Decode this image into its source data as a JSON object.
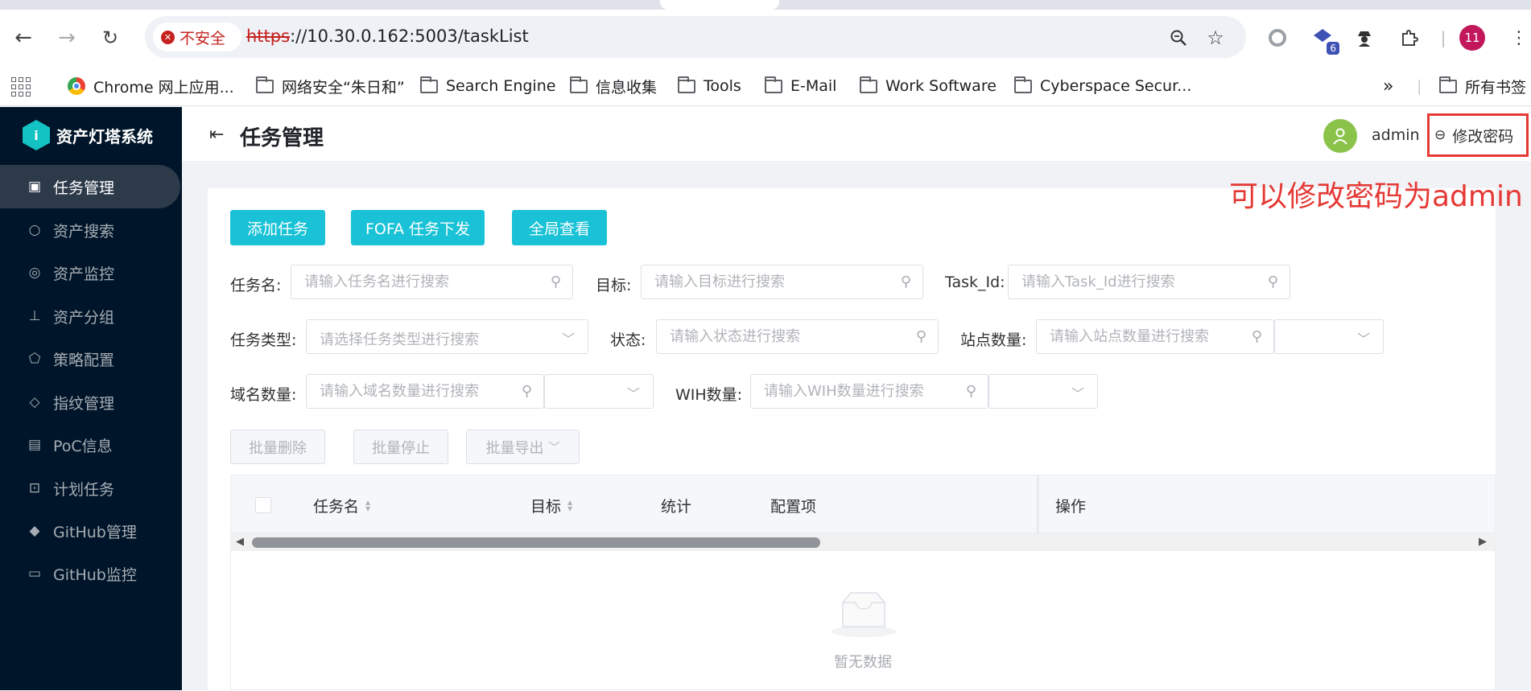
{
  "browser": {
    "insecure_label": "不安全",
    "url_scheme": "https",
    "url_rest": "://10.30.0.162:5003/taskList",
    "profile_initials": "11",
    "extension_badge": "6",
    "bookmarks": [
      "Chrome 网上应用...",
      "网络安全“朱日和”",
      "Search Engine",
      "信息收集",
      "Tools",
      "E-Mail",
      "Work Software",
      "Cyberspace Secur..."
    ],
    "all_bookmarks": "所有书签",
    "overflow": "»"
  },
  "sidebar": {
    "brand": "资产灯塔系统",
    "items": [
      {
        "label": "任务管理",
        "icon": "task-icon"
      },
      {
        "label": "资产搜索",
        "icon": "search-icon"
      },
      {
        "label": "资产监控",
        "icon": "shield-icon"
      },
      {
        "label": "资产分组",
        "icon": "group-icon"
      },
      {
        "label": "策略配置",
        "icon": "policy-icon"
      },
      {
        "label": "指纹管理",
        "icon": "tag-icon"
      },
      {
        "label": "PoC信息",
        "icon": "document-icon"
      },
      {
        "label": "计划任务",
        "icon": "terminal-icon"
      },
      {
        "label": "GitHub管理",
        "icon": "git-icon"
      },
      {
        "label": "GitHub监控",
        "icon": "monitor-icon"
      }
    ]
  },
  "header": {
    "title": "任务管理",
    "username": "admin",
    "change_password": "修改密码"
  },
  "annotation": "可以修改密码为admin",
  "actions": {
    "add_task": "添加任务",
    "fofa_task": "FOFA 任务下发",
    "global_view": "全局查看"
  },
  "filters": {
    "task_name": {
      "label": "任务名:",
      "placeholder": "请输入任务名进行搜索"
    },
    "target": {
      "label": "目标:",
      "placeholder": "请输入目标进行搜索"
    },
    "task_id": {
      "label": "Task_Id:",
      "placeholder": "请输入Task_Id进行搜索"
    },
    "task_type": {
      "label": "任务类型:",
      "placeholder": "请选择任务类型进行搜索"
    },
    "status": {
      "label": "状态:",
      "placeholder": "请输入状态进行搜索"
    },
    "site_count": {
      "label": "站点数量:",
      "placeholder": "请输入站点数量进行搜索"
    },
    "domain_count": {
      "label": "域名数量:",
      "placeholder": "请输入域名数量进行搜索"
    },
    "wih_count": {
      "label": "WIH数量:",
      "placeholder": "请输入WIH数量进行搜索"
    }
  },
  "batch": {
    "delete": "批量删除",
    "stop": "批量停止",
    "export": "批量导出"
  },
  "table": {
    "columns": [
      "任务名",
      "目标",
      "统计",
      "配置项",
      "操作"
    ],
    "empty_text": "暂无数据"
  },
  "colors": {
    "sidebar_bg": "#001529",
    "primary_button": "#19c2d6",
    "annotation": "#e53935"
  }
}
